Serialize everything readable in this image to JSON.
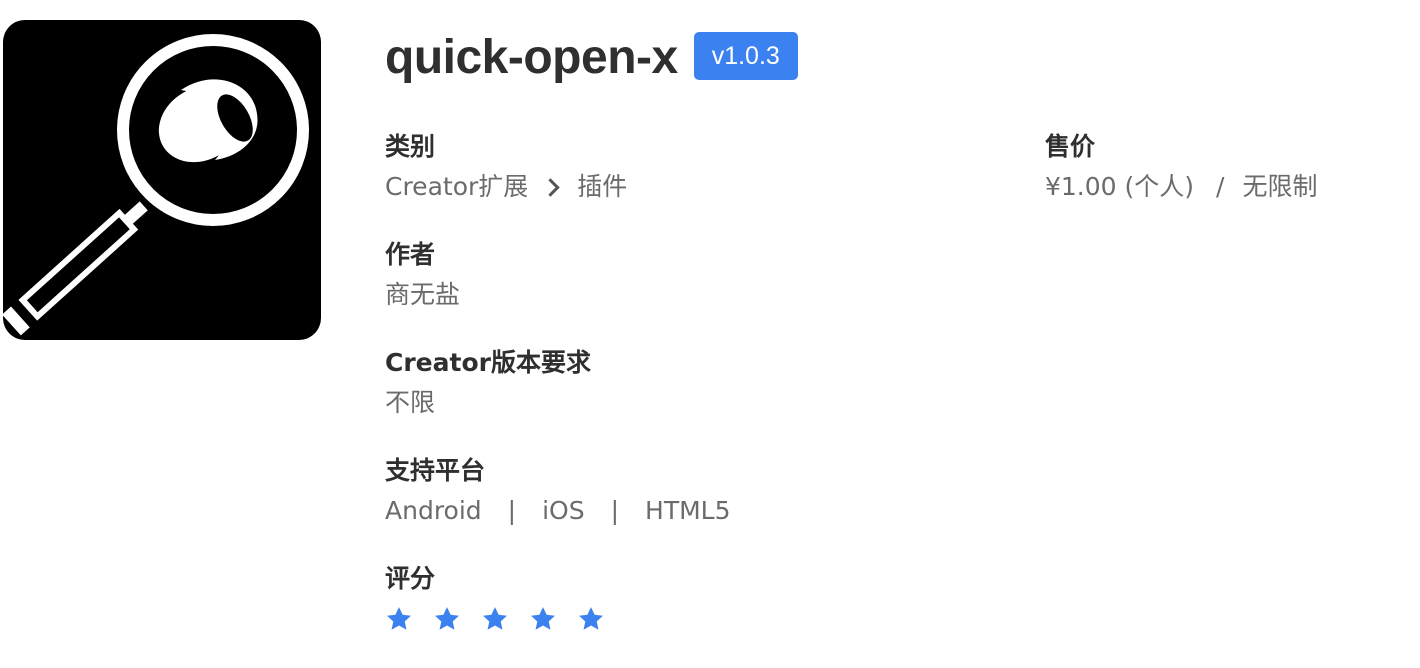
{
  "app": {
    "icon": "magnifying-glass-icon",
    "title": "quick-open-x",
    "version": "v1.0.3"
  },
  "category": {
    "label": "类别",
    "path": [
      "Creator扩展",
      "插件"
    ]
  },
  "price": {
    "label": "售价",
    "amount": "¥1.00 (个人)",
    "separator": "/",
    "license": "无限制"
  },
  "author": {
    "label": "作者",
    "name": "商无盐"
  },
  "creator_version": {
    "label": "Creator版本要求",
    "value": "不限"
  },
  "platforms": {
    "label": "支持平台",
    "items": [
      "Android",
      "iOS",
      "HTML5"
    ],
    "separator": "|"
  },
  "rating": {
    "label": "评分",
    "stars": 5,
    "max": 5,
    "star_color": "#3b82f0"
  },
  "colors": {
    "accent": "#3b82f0",
    "heading": "#2f2f2f",
    "text": "#6b6b6b"
  }
}
